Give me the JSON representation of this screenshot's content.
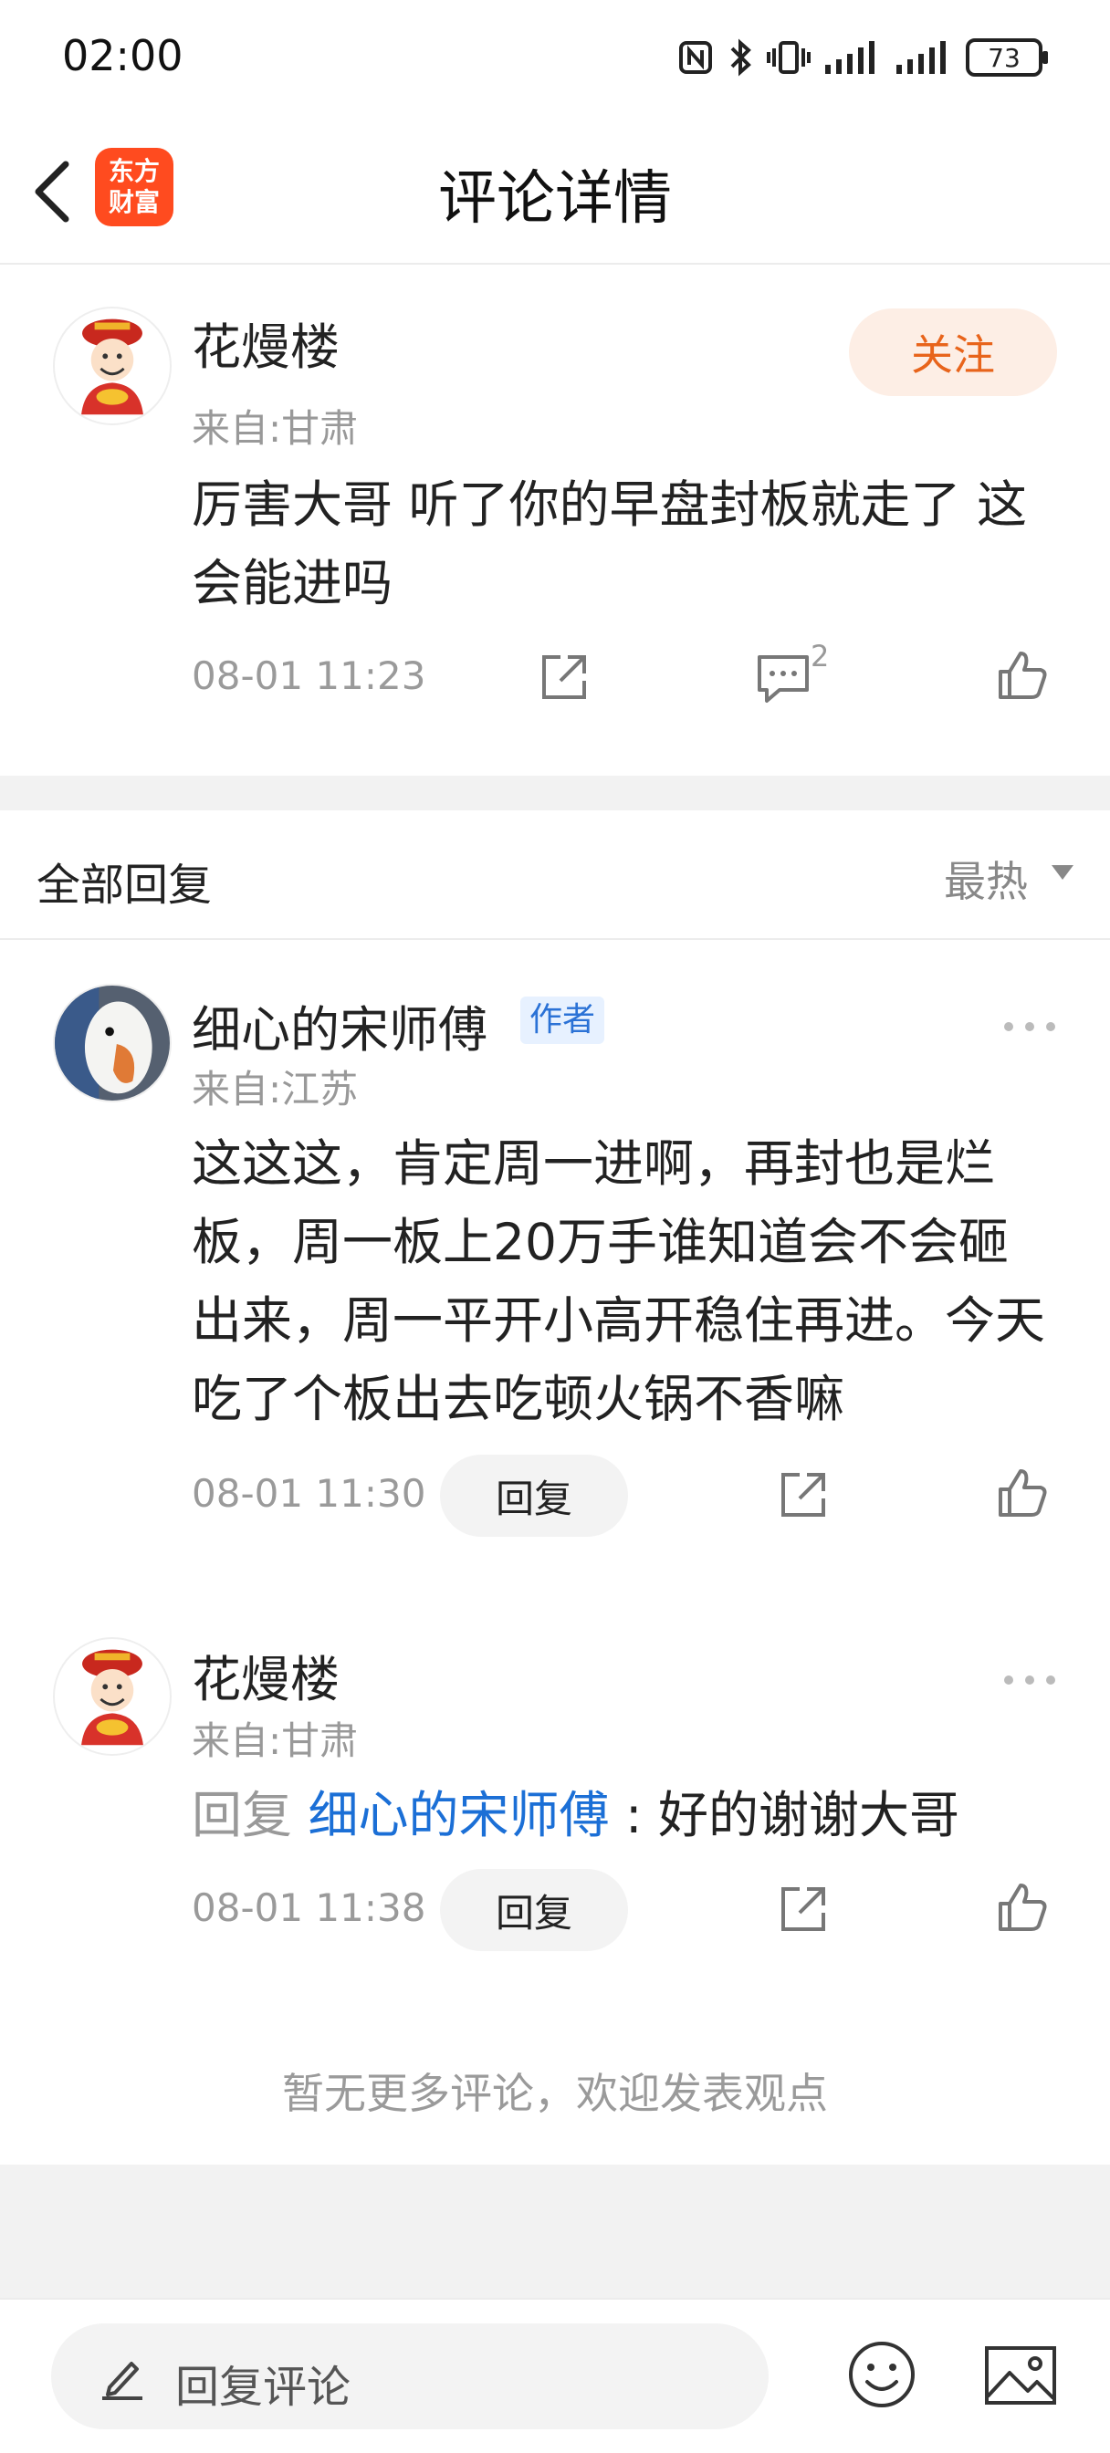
{
  "status_bar": {
    "time": "02:00",
    "battery": "73"
  },
  "header": {
    "title": "评论详情",
    "logo_line1": "东方",
    "logo_line2": "财富"
  },
  "main_comment": {
    "username": "花熳楼",
    "location": "来自:甘肃",
    "follow_label": "关注",
    "text": "厉害大哥 听了你的早盘封板就走了 这会能进吗",
    "time": "08-01 11:23",
    "reply_count": "2"
  },
  "replies_header": {
    "title": "全部回复",
    "sort_label": "最热"
  },
  "replies": [
    {
      "username": "细心的宋师傅",
      "badge": "作者",
      "location": "来自:江苏",
      "text": "这这这，肯定周一进啊，再封也是烂板，周一板上20万手谁知道会不会砸出来，周一平开小高开稳住再进。今天吃了个板出去吃顿火锅不香嘛",
      "time": "08-01 11:30",
      "reply_label": "回复"
    },
    {
      "username": "花熳楼",
      "location": "来自:甘肃",
      "reply_prefix": "回复 ",
      "mention": "细心的宋师傅",
      "reply_rest": " : 好的谢谢大哥",
      "time": "08-01 11:38",
      "reply_label": "回复"
    }
  ],
  "no_more_text": "暂无更多评论，欢迎发表观点",
  "bottom_bar": {
    "input_placeholder": "回复评论"
  },
  "colors": {
    "accent_orange": "#e8641b",
    "logo_red": "#ff4b1f",
    "mention_blue": "#1b6fd6"
  }
}
